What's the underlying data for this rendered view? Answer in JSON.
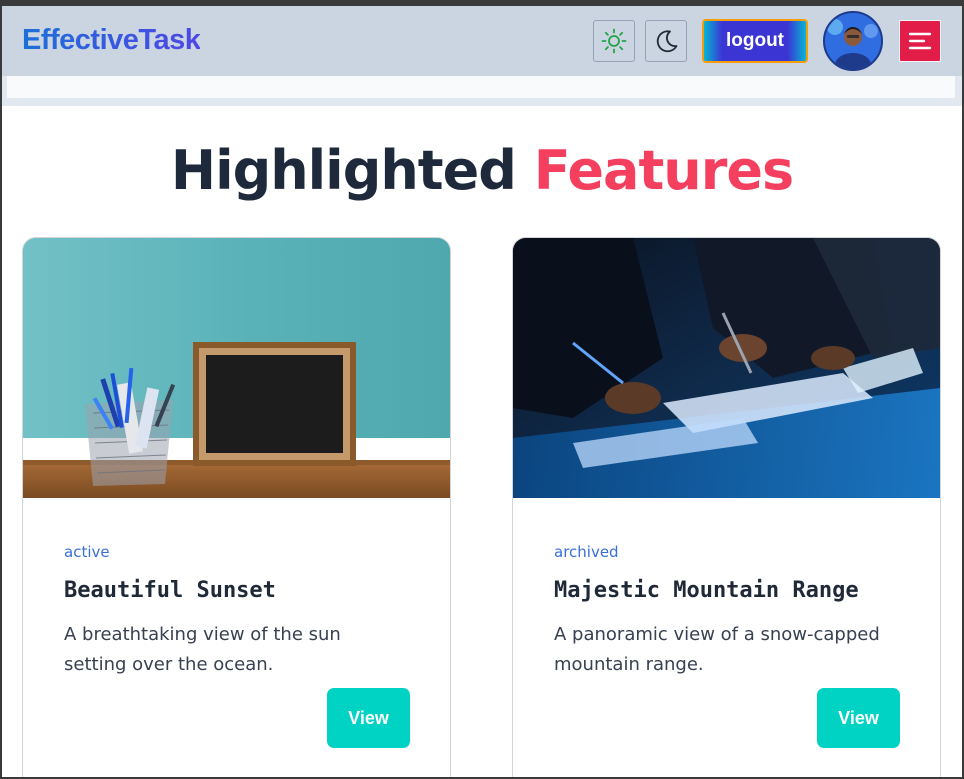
{
  "navbar": {
    "brand": "EffectiveTask",
    "logout_label": "logout"
  },
  "section": {
    "heading_part1": "Highlighted",
    "heading_part2": "Features"
  },
  "cards": [
    {
      "status": "active",
      "title": "Beautiful Sunset",
      "description": "A breathtaking view of the sun setting over the ocean.",
      "button_label": "View"
    },
    {
      "status": "archived",
      "title": "Majestic Mountain Range",
      "description": "A panoramic view of a snow-capped mountain range.",
      "button_label": "View"
    }
  ],
  "colors": {
    "navbar_bg": "#cbd5e1",
    "accent_pink": "#f43f5e",
    "menu_red": "#e11d48",
    "view_teal": "#00d2c4",
    "status_blue": "#3b6fd8"
  },
  "icons": {
    "theme_light": "sun-icon",
    "theme_dark": "moon-icon",
    "menu": "hamburger-menu-icon"
  }
}
